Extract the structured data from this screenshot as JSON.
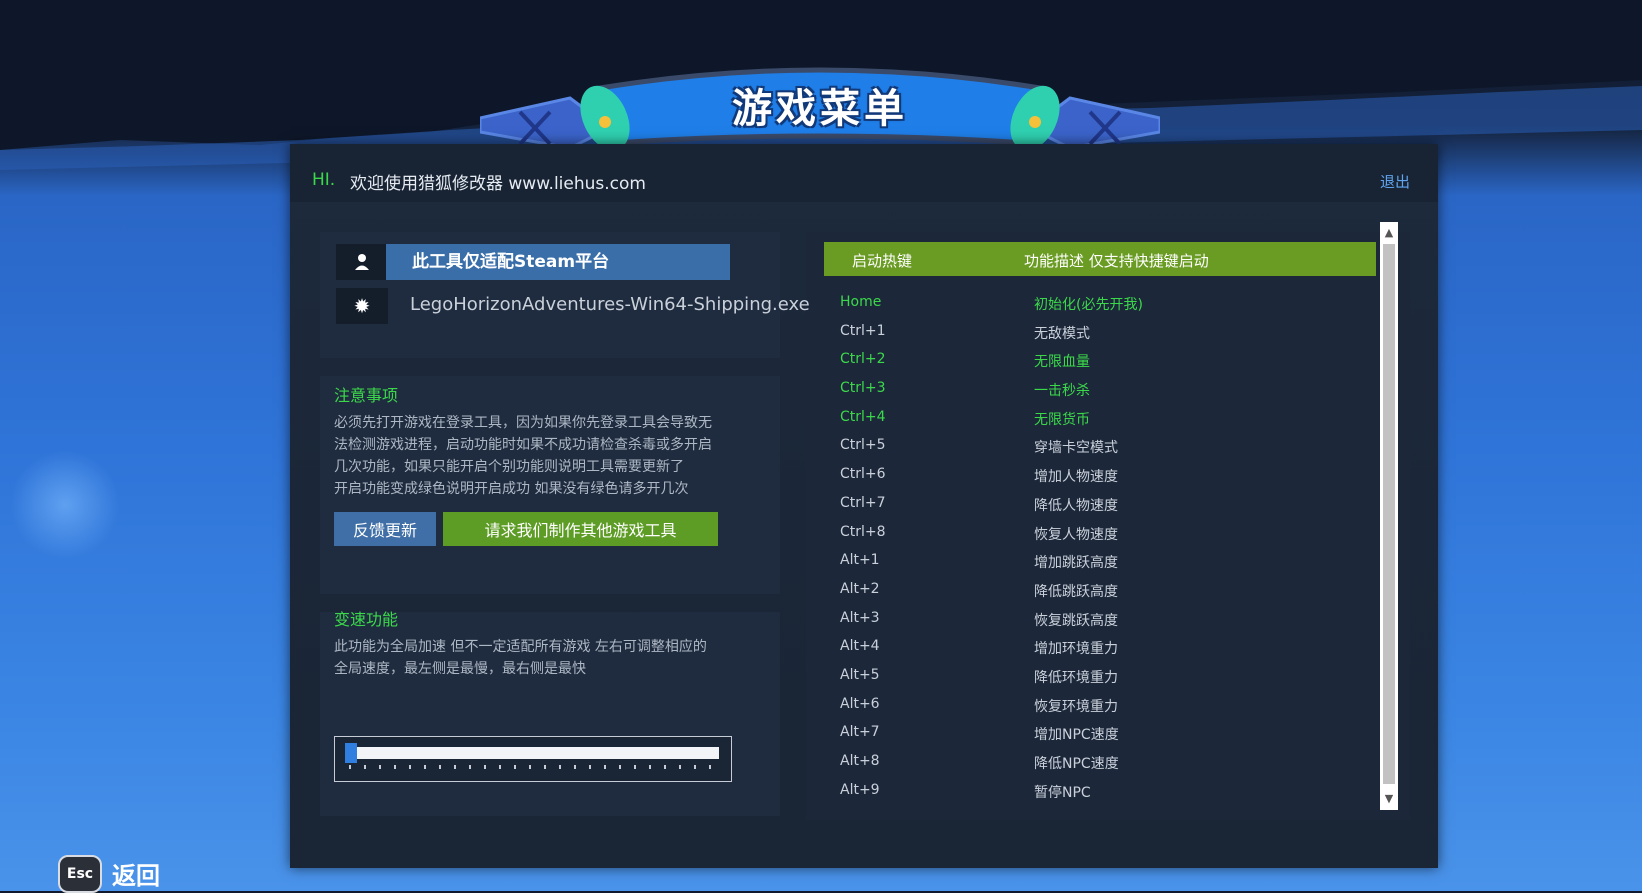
{
  "banner": {
    "title": "游戏菜单"
  },
  "topbar": {
    "hi": "HI.",
    "welcome": "欢迎使用猎狐修改器 www.liehus.com",
    "logout": "退出"
  },
  "platform": {
    "steam_label": "此工具仅适配Steam平台",
    "exe": "LegoHorizonAdventures-Win64-Shipping.exe",
    "user_icon": "user-icon",
    "gear_icon": "gear-icon"
  },
  "notes": {
    "title": "注意事项",
    "lines": [
      "必须先打开游戏在登录工具，因为如果你先登录工具会导致无",
      "法检测游戏进程，启动功能时如果不成功请检查杀毒或多开启",
      "几次功能，如果只能开启个别功能则说明工具需要更新了",
      "开启功能变成绿色说明开启成功 如果没有绿色请多开几次"
    ],
    "feedback_button": "反馈更新",
    "request_button": "请求我们制作其他游戏工具"
  },
  "speed": {
    "title": "变速功能",
    "lines": [
      "此功能为全局加速 但不一定适配所有游戏 左右可调整相应的",
      "全局速度，最左侧是最慢，最右侧是最快"
    ],
    "slider_value": 0
  },
  "hotkeys": {
    "header_key": "启动热键",
    "header_desc": "功能描述 仅支持快捷键启动",
    "rows": [
      {
        "key": "Home",
        "desc": "初始化(必先开我)",
        "active": true
      },
      {
        "key": "Ctrl+1",
        "desc": "无敌模式",
        "active": false
      },
      {
        "key": "Ctrl+2",
        "desc": "无限血量",
        "active": true
      },
      {
        "key": "Ctrl+3",
        "desc": "一击秒杀",
        "active": true
      },
      {
        "key": "Ctrl+4",
        "desc": "无限货币",
        "active": true
      },
      {
        "key": "Ctrl+5",
        "desc": "穿墙卡空模式",
        "active": false
      },
      {
        "key": "Ctrl+6",
        "desc": "增加人物速度",
        "active": false
      },
      {
        "key": "Ctrl+7",
        "desc": "降低人物速度",
        "active": false
      },
      {
        "key": "Ctrl+8",
        "desc": "恢复人物速度",
        "active": false
      },
      {
        "key": "Alt+1",
        "desc": "增加跳跃高度",
        "active": false
      },
      {
        "key": "Alt+2",
        "desc": "降低跳跃高度",
        "active": false
      },
      {
        "key": "Alt+3",
        "desc": "恢复跳跃高度",
        "active": false
      },
      {
        "key": "Alt+4",
        "desc": "增加环境重力",
        "active": false
      },
      {
        "key": "Alt+5",
        "desc": "降低环境重力",
        "active": false
      },
      {
        "key": "Alt+6",
        "desc": "恢复环境重力",
        "active": false
      },
      {
        "key": "Alt+7",
        "desc": "增加NPC速度",
        "active": false
      },
      {
        "key": "Alt+8",
        "desc": "降低NPC速度",
        "active": false
      },
      {
        "key": "Alt+9",
        "desc": "暂停NPC",
        "active": false
      }
    ]
  },
  "footer": {
    "esc_key": "Esc",
    "back_label": "返回"
  },
  "colors": {
    "active_green": "#3bd94a",
    "header_green": "#6a9b22",
    "accent_blue": "#3a6ea8"
  }
}
